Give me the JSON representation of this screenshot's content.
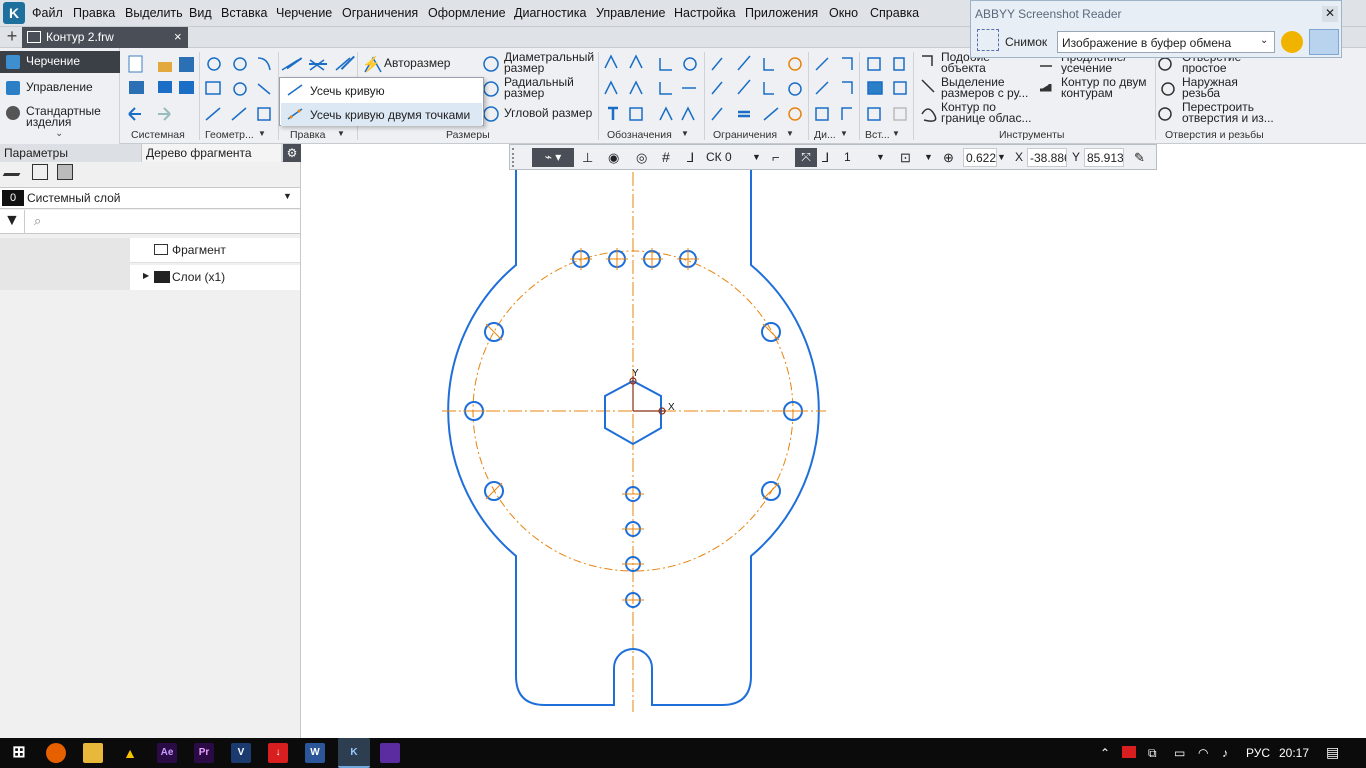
{
  "menubar": {
    "items": [
      "Файл",
      "Правка",
      "Выделить",
      "Вид",
      "Вставка",
      "Черчение",
      "Ограничения",
      "Оформление",
      "Диагностика",
      "Управление",
      "Настройка",
      "Приложения",
      "Окно",
      "Справка"
    ]
  },
  "tab": {
    "label": "Контур 2.frw",
    "close": "×"
  },
  "modes": [
    "Черчение",
    "Управление",
    "Стандартные изделия"
  ],
  "ribbon": {
    "autosize": "Авторазмер",
    "diam": "Диаметральный размер",
    "radial": "Радиальный размер",
    "angular": "Угловой размер",
    "similar": "Подобие объекта",
    "extend": "Продление/ усечение",
    "dim_select": "Выделение размеров с ру...",
    "contour_two": "Контур по двум контурам",
    "contour_area": "Контур по границе облас...",
    "hole_simple": "Отверстие простое",
    "outer_thread": "Наружная резьба",
    "rebuild_holes": "Перестроить отверстия и из...",
    "groups": [
      "Системная",
      "Геометр...",
      "Правка",
      "Размеры",
      "Обозначения",
      "Ограничения",
      "Ди...",
      "Вст...",
      "Инструменты",
      "Отверстия и резьбы"
    ]
  },
  "dropdown": {
    "items": [
      "Усечь кривую",
      "Усечь кривую двумя точками"
    ]
  },
  "abbyy": {
    "title": "ABBYY Screenshot Reader",
    "snap": "Снимок",
    "mode": "Изображение в буфер обмена"
  },
  "left_panel": {
    "tabs": [
      "Параметры",
      "Дерево фрагмента"
    ],
    "layer_num": "0",
    "layer": "Системный слой",
    "tree": {
      "fragment": "Фрагмент",
      "layers": "Слои (x1)"
    }
  },
  "ctx": {
    "cs": "СК 0",
    "step": "1",
    "zoom": "0.622",
    "x_label": "X",
    "x_val": "-38.886",
    "y_label": "Y",
    "y_val": "85.913"
  },
  "axes": {
    "x": "X",
    "y": "Y"
  },
  "taskbar": {
    "lang": "РУС",
    "time": "20:17"
  },
  "colors": {
    "contour": "#1e6fd9",
    "center": "#e8830c",
    "axis": "#c0392b",
    "accent": "#1d6f9e"
  }
}
